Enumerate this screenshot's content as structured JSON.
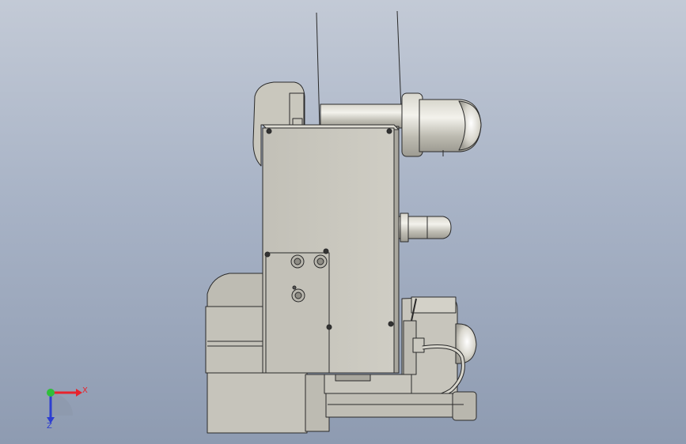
{
  "triad": {
    "x_label": "X",
    "z_label": "Z",
    "x_color": "#e8232c",
    "y_color": "#2fbf3a",
    "z_color": "#2d3ed1"
  },
  "model": {
    "body_color": "#c9c7bd",
    "shade_color": "#a9a79e",
    "edge_color": "#2a2a2a"
  }
}
